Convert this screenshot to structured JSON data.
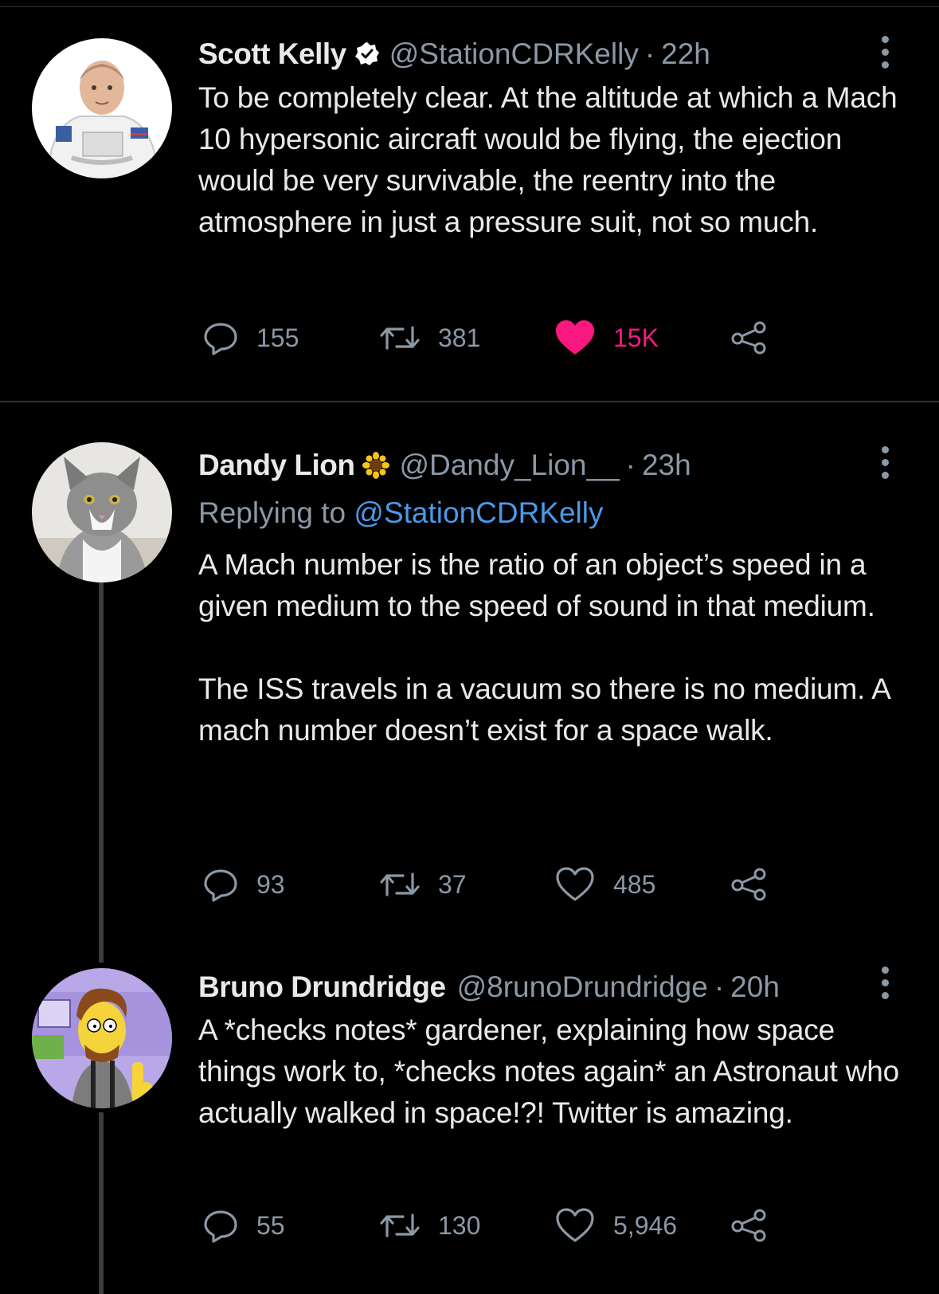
{
  "theme": {
    "background": "#000000",
    "text": "#e7e9ea",
    "muted": "#8b98a5",
    "link": "#4a99e9",
    "like_active": "#f91880",
    "verified_badge": "#ffffff"
  },
  "tweets": [
    {
      "author_name": "Scott Kelly",
      "badge_icon": "verified-icon",
      "handle": "@StationCDRKelly",
      "separator": "·",
      "time": "22h",
      "replying_prefix": "",
      "replying_to": "",
      "body": [
        "To be completely clear. At the altitude at which a Mach 10 hypersonic aircraft would be flying, the ejection would be very survivable, the reentry into the atmosphere in just a pressure suit, not so much."
      ],
      "stats": {
        "replies": "155",
        "retweets": "381",
        "likes": "15K",
        "liked": true
      }
    },
    {
      "author_name": "Dandy Lion",
      "badge_icon": "sunflower-icon",
      "handle": "@Dandy_Lion__",
      "separator": "·",
      "time": "23h",
      "replying_prefix": "Replying to",
      "replying_to": "@StationCDRKelly",
      "body": [
        "A Mach number is the ratio of an object’s speed in a given medium to the speed of sound in that medium.",
        "The ISS travels in a vacuum so there is no medium. A mach number doesn’t exist for a space walk."
      ],
      "stats": {
        "replies": "93",
        "retweets": "37",
        "likes": "485",
        "liked": false
      }
    },
    {
      "author_name": "Bruno Drundridge",
      "badge_icon": "",
      "handle": "@8runoDrundridge",
      "separator": "·",
      "time": "20h",
      "replying_prefix": "",
      "replying_to": "",
      "body": [
        "A *checks notes* gardener, explaining how space things work to, *checks notes again* an Astronaut who actually walked in space!?! Twitter is amazing."
      ],
      "stats": {
        "replies": "55",
        "retweets": "130",
        "likes": "5,946",
        "liked": false
      }
    }
  ],
  "icons": {
    "reply": "reply-icon",
    "retweet": "retweet-icon",
    "like": "heart-icon",
    "share": "share-icon",
    "more": "more-options-icon"
  }
}
